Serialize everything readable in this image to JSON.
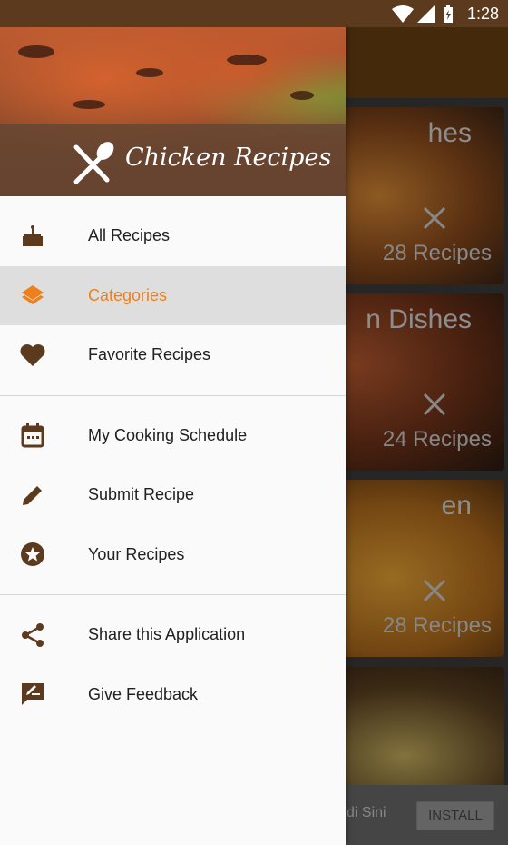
{
  "status_bar": {
    "time": "1:28",
    "icons": [
      "wifi-icon",
      "signal-icon",
      "battery-icon"
    ]
  },
  "background": {
    "categories": [
      {
        "title_partial": "hes",
        "count": "28 Recipes"
      },
      {
        "title_partial": "n Dishes",
        "count": "24 Recipes"
      },
      {
        "title_partial": "en",
        "count": "28 Recipes"
      },
      {
        "title_partial": "",
        "count": ""
      }
    ],
    "ad": {
      "text": "di Sini",
      "button": "INSTALL"
    }
  },
  "drawer": {
    "brand": "Chicken Recipes",
    "sections": [
      [
        {
          "label": "All Recipes",
          "icon": "cake-icon",
          "active": false
        },
        {
          "label": "Categories",
          "icon": "layers-icon",
          "active": true
        },
        {
          "label": "Favorite Recipes",
          "icon": "heart-icon",
          "active": false
        }
      ],
      [
        {
          "label": "My Cooking Schedule",
          "icon": "calendar-icon",
          "active": false
        },
        {
          "label": "Submit Recipe",
          "icon": "pencil-icon",
          "active": false
        },
        {
          "label": "Your Recipes",
          "icon": "star-circle-icon",
          "active": false
        }
      ],
      [
        {
          "label": "Share this Application",
          "icon": "share-icon",
          "active": false
        },
        {
          "label": "Give Feedback",
          "icon": "feedback-icon",
          "active": false
        }
      ]
    ]
  },
  "colors": {
    "accent": "#ef7f1a",
    "icon": "#5c3a1e",
    "status_bar": "#5c3a1e",
    "toolbar": "#6b3f12"
  }
}
